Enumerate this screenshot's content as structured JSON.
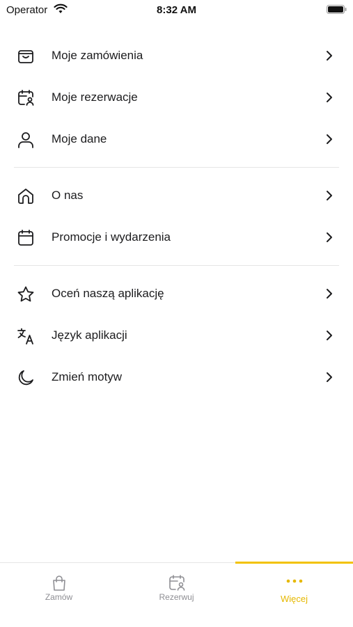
{
  "status": {
    "carrier": "Operator",
    "time": "8:32 AM"
  },
  "menu": {
    "section1": [
      {
        "label": "Moje zamówienia",
        "icon": "bag-icon"
      },
      {
        "label": "Moje rezerwacje",
        "icon": "calendar-user-icon"
      },
      {
        "label": "Moje dane",
        "icon": "user-icon"
      }
    ],
    "section2": [
      {
        "label": "O nas",
        "icon": "home-icon"
      },
      {
        "label": "Promocje i wydarzenia",
        "icon": "calendar-icon"
      }
    ],
    "section3": [
      {
        "label": "Oceń naszą aplikację",
        "icon": "star-icon"
      },
      {
        "label": "Język aplikacji",
        "icon": "translate-icon"
      },
      {
        "label": "Zmień motyw",
        "icon": "moon-icon"
      }
    ]
  },
  "tabbar": {
    "tabs": [
      {
        "label": "Zamów",
        "icon": "shopping-bag-icon"
      },
      {
        "label": "Rezerwuj",
        "icon": "calendar-user-icon"
      },
      {
        "label": "Więcej",
        "icon": "more-dots-icon"
      }
    ],
    "active_index": 2,
    "accent_color": "#f2c200"
  }
}
